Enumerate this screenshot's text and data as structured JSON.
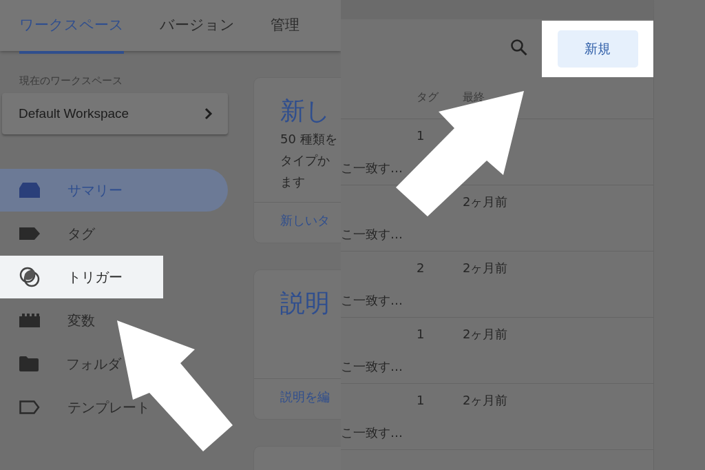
{
  "tabs": [
    {
      "label": "ワークスペース",
      "selected": true
    },
    {
      "label": "バージョン",
      "selected": false
    },
    {
      "label": "管理",
      "selected": false
    }
  ],
  "workspace": {
    "label": "現在のワークスペース",
    "name": "Default Workspace"
  },
  "sidebar": {
    "items": [
      {
        "label": "サマリー",
        "kind": "summary",
        "selected": true,
        "highlighted": false
      },
      {
        "label": "タグ",
        "kind": "tag",
        "selected": false,
        "highlighted": false
      },
      {
        "label": "トリガー",
        "kind": "trigger",
        "selected": false,
        "highlighted": true
      },
      {
        "label": "変数",
        "kind": "variable",
        "selected": false,
        "highlighted": false
      },
      {
        "label": "フォルダ",
        "kind": "folder",
        "selected": false,
        "highlighted": false
      },
      {
        "label": "テンプレート",
        "kind": "template",
        "selected": false,
        "highlighted": false
      }
    ]
  },
  "cards": [
    {
      "title": "新し",
      "lines": [
        "50 種類を",
        "タイプか",
        "ます"
      ],
      "link": "新しいタ"
    },
    {
      "title": "説明",
      "link": "説明を編"
    }
  ],
  "table": {
    "new_button": "新規",
    "columns": [
      "タグ",
      "最終"
    ],
    "rows": [
      {
        "name": "こ一致す…",
        "tags": "1",
        "updated": ""
      },
      {
        "name": "こ一致す…",
        "tags": "",
        "updated": "2ヶ月前"
      },
      {
        "name": "こ一致す…",
        "tags": "2",
        "updated": "2ヶ月前"
      },
      {
        "name": "こ一致す…",
        "tags": "1",
        "updated": "2ヶ月前"
      },
      {
        "name": "こ一致す…",
        "tags": "1",
        "updated": "2ヶ月前"
      }
    ]
  }
}
